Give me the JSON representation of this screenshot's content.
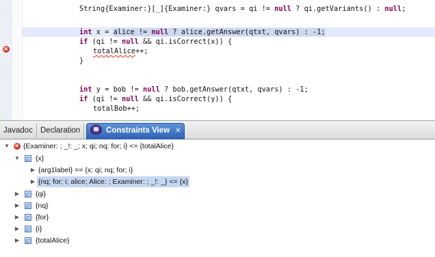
{
  "editor": {
    "lines": [
      {
        "text": "String{Examiner:}[_]{Examiner:} qvars = qi != null ? qi.getVariants() : null;"
      },
      {
        "pre": "int x = ",
        "sel": "alice != null ? alice.getAnswer(qtxt, qvars) : -1;"
      },
      {
        "text": "if (qi != null && qi.isCorrect(x)) {"
      },
      {
        "squiggle": "totalAlice",
        "post": "++;"
      },
      {
        "text": "}"
      },
      {
        "text": "int y = bob != null ? bob.getAnswer(qtxt, qvars) : -1;"
      },
      {
        "text": "if (qi != null && qi.isCorrect(y)) {"
      },
      {
        "text": "totalBob++;"
      }
    ]
  },
  "tabs": {
    "javadoc": "Javadoc",
    "declaration": "Declaration",
    "constraints": "Constraints View",
    "close": "✕"
  },
  "tree": {
    "root": "{Examiner: ; _!: _; x; qi; nq; for; i} <= {totalAlice}",
    "x": "{x}",
    "x_child1": "{arg1label} == {x; qi; nq; for; i}",
    "x_child2": "{nq; for; i; alice; Alice: ; Examiner: ; _!: _} <= {x}",
    "qi": "{qi}",
    "nq": "{nq}",
    "for": "{for}",
    "i": "{i}",
    "totalAlice": "{totalAlice}"
  },
  "icons": {
    "error": "error-icon",
    "node": "constraint-node-icon",
    "view": "constraints-view-icon"
  },
  "colors": {
    "highlight_line": "#e3ebfa",
    "selection": "#cdd9ef",
    "active_tab": "#2c60b2",
    "error": "#c8271a"
  }
}
